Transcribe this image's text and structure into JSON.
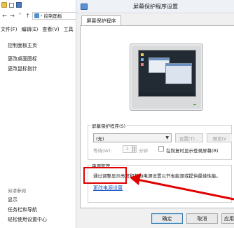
{
  "control_panel": {
    "address_text": "控制面板",
    "menu": [
      "文件(F)",
      "编辑(E)",
      "查看(V)",
      "工具"
    ],
    "links": [
      "控制面板主页",
      "更改桌面图标",
      "更改鼠标指针"
    ],
    "see_also_heading": "另请参阅",
    "see_also_links": [
      "显示",
      "任务栏和导航",
      "轻松使用设置中心"
    ]
  },
  "dialog": {
    "title": "屏幕保护程序设置",
    "tab_label": "屏幕保护程序",
    "screensaver": {
      "legend": "屏幕保护程序(S)",
      "selected": "(无)",
      "settings_button": "设置(T)...",
      "preview_button": "预览(V",
      "wait_label": "等待(W):",
      "wait_value": "1",
      "wait_unit": "分钟",
      "resume_label": "在恢复时显示登录屏幕(R)"
    },
    "power": {
      "legend": "电源管理",
      "description": "通过调整显示亮度和其他电源设置以节省能源或提供最佳性能。",
      "link": "更改电源设置"
    },
    "buttons": {
      "ok": "确定",
      "cancel": "取消",
      "apply": "应用"
    }
  },
  "colors": {
    "highlight": "#e00000",
    "link": "#1a55c4"
  }
}
